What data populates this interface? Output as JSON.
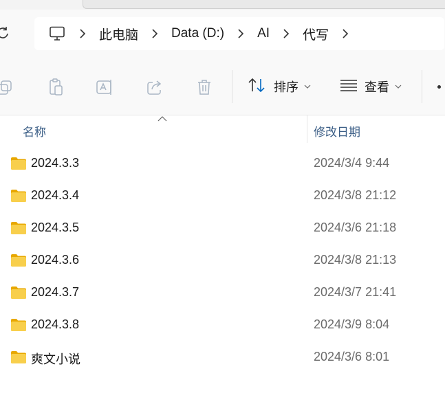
{
  "breadcrumb": [
    "此电脑",
    "Data (D:)",
    "AI",
    "代写"
  ],
  "toolbar": {
    "sort_label": "排序",
    "view_label": "查看"
  },
  "columns": {
    "name": "名称",
    "date_modified": "修改日期"
  },
  "files": [
    {
      "name": "2024.3.3",
      "date": "2024/3/4 9:44"
    },
    {
      "name": "2024.3.4",
      "date": "2024/3/8 21:12"
    },
    {
      "name": "2024.3.5",
      "date": "2024/3/6 21:18"
    },
    {
      "name": "2024.3.6",
      "date": "2024/3/8 21:13"
    },
    {
      "name": "2024.3.7",
      "date": "2024/3/7 21:41"
    },
    {
      "name": "2024.3.8",
      "date": "2024/3/9 8:04"
    },
    {
      "name": "爽文小说",
      "date": "2024/3/6 8:01"
    }
  ],
  "colors": {
    "accent": "#0067c0",
    "folder_yellow": "#f5c542",
    "header_text": "#3b5e86"
  },
  "icons": {
    "refresh": "refresh-icon",
    "computer": "computer-icon",
    "copy": "copy-icon",
    "paste": "paste-icon",
    "rename": "rename-icon",
    "share": "share-icon",
    "delete": "trash-icon",
    "sort": "sort-icon",
    "view": "view-icon",
    "folder": "folder-icon"
  }
}
